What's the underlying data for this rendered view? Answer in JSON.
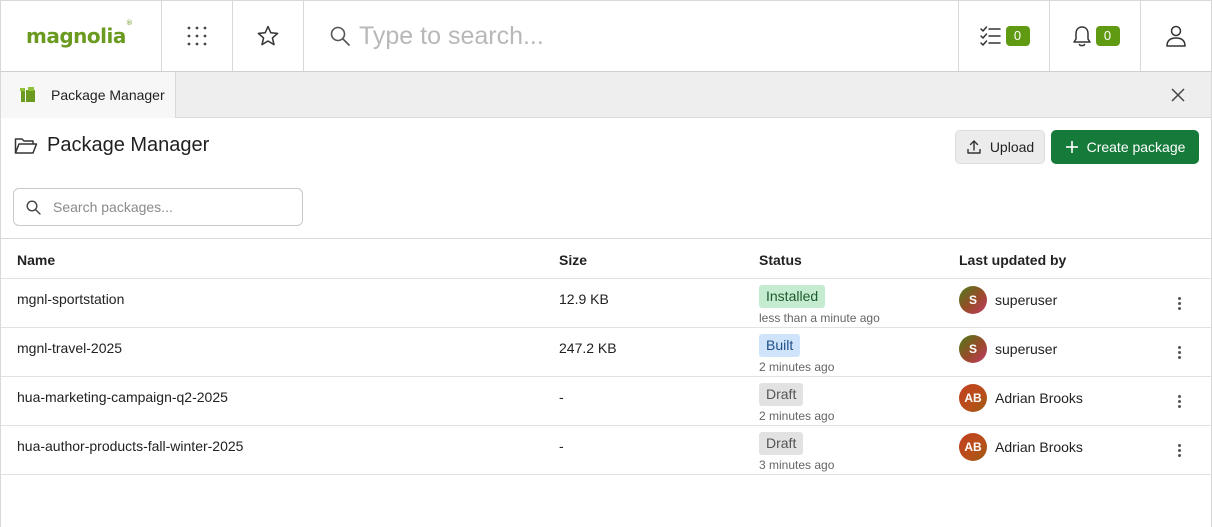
{
  "header": {
    "logo_text": "magnolia",
    "logo_mark": "®",
    "apps_icon": "grid-icon",
    "favorites_icon": "star-icon",
    "search_placeholder": "Type to search...",
    "tasks_count": "0",
    "notifications_count": "0",
    "accent_color": "#5f9a12"
  },
  "tab": {
    "label": "Package Manager",
    "icon": "package-icon"
  },
  "page": {
    "title": "Package Manager",
    "upload_label": "Upload",
    "create_label": "Create package",
    "search_placeholder": "Search packages...",
    "primary_color": "#167a3b"
  },
  "table": {
    "columns": {
      "name": "Name",
      "size": "Size",
      "status": "Status",
      "updated_by": "Last updated by"
    },
    "rows": [
      {
        "name": "mgnl-sportstation",
        "size": "12.9 KB",
        "status": "Installed",
        "status_time": "less than a minute ago",
        "initials": "S",
        "user": "superuser"
      },
      {
        "name": "mgnl-travel-2025",
        "size": "247.2 KB",
        "status": "Built",
        "status_time": "2 minutes ago",
        "initials": "S",
        "user": "superuser"
      },
      {
        "name": "hua-marketing-campaign-q2-2025",
        "size": "-",
        "status": "Draft",
        "status_time": "2 minutes ago",
        "initials": "AB",
        "user": "Adrian Brooks"
      },
      {
        "name": "hua-author-products-fall-winter-2025",
        "size": "-",
        "status": "Draft",
        "status_time": "3 minutes ago",
        "initials": "AB",
        "user": "Adrian Brooks"
      }
    ]
  }
}
